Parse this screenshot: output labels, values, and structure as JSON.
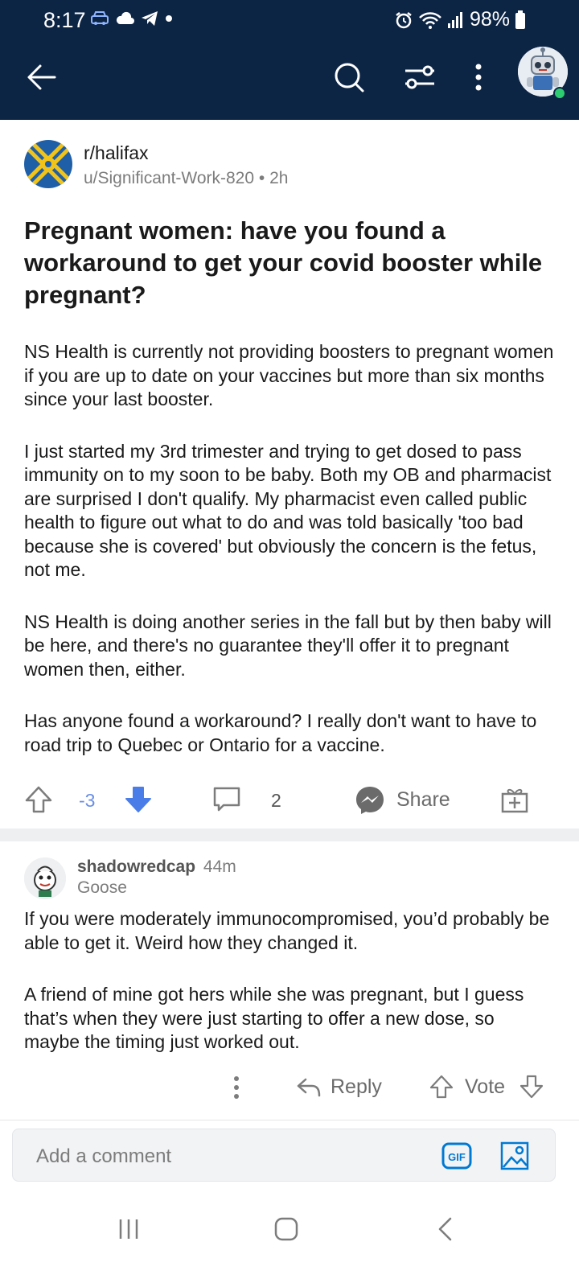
{
  "status_bar": {
    "time": "8:17",
    "battery": "98%"
  },
  "header": {
    "back_icon": "arrow-left-icon",
    "search_icon": "search-icon",
    "filter_icon": "sort-filter-icon",
    "more_icon": "more-vertical-icon",
    "avatar_icon": "user-avatar"
  },
  "post": {
    "subreddit": "r/halifax",
    "author": "u/Significant-Work-820",
    "separator": "•",
    "age": "2h",
    "title": "Pregnant women: have you found a workaround to get your covid booster while pregnant?",
    "body": [
      "NS Health is currently not providing boosters to pregnant women if you are up to date on your vaccines but more than six months since your last booster.",
      "I just started my 3rd trimester and trying to get dosed to pass immunity on to my soon to be baby. Both my OB and pharmacist are surprised I don't qualify. My pharmacist even called public health to figure out what to do and was told basically 'too bad because she is covered' but obviously the concern is the fetus, not me.",
      "NS Health is doing another series in the fall but by then baby will be here, and there's no guarantee they'll offer it to pregnant women then, either.",
      "Has anyone found a workaround? I really don't want to have to road trip to Quebec or Ontario for a vaccine."
    ],
    "score": "-3",
    "comment_count": "2",
    "share_label": "Share",
    "colors": {
      "downvote_active": "#4a7de8",
      "score": "#6a8fe6"
    }
  },
  "comment": {
    "author": "shadowredcap",
    "age": "44m",
    "flair": "Goose",
    "body": [
      "If you were moderately immunocompromised, you’d probably be able to get it. Weird how they changed it.",
      "A friend of mine got hers while she was pregnant, but I guess that’s when they were just starting to offer a new dose, so maybe the timing just worked out."
    ],
    "reply_label": "Reply",
    "vote_label": "Vote"
  },
  "composer": {
    "placeholder": "Add a comment",
    "gif_label": "GIF"
  },
  "theme": {
    "header_bg": "#0d2545",
    "accent": "#0079d3"
  }
}
